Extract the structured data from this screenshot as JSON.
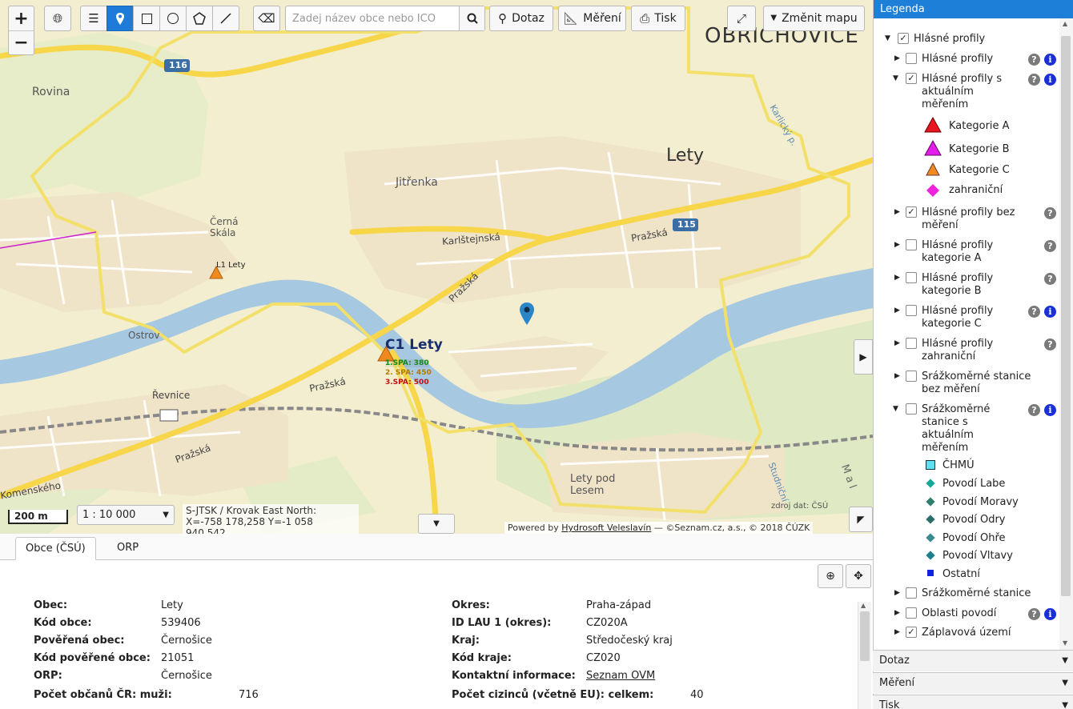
{
  "toolbar": {
    "zoom_in": "+",
    "zoom_out": "−",
    "search_placeholder": "Zadej název obce nebo IČO",
    "query_label": "Dotaz",
    "measure_label": "Měření",
    "print_label": "Tisk",
    "change_map_label": "Změnit mapu"
  },
  "map": {
    "scale_bar": "200 m",
    "scale_select": "1 : 10 000",
    "coords_line1": "S-JTSK / Krovak East North:",
    "coords_line2": "X=-758 178,258 Y=-1 058 940,542",
    "source_note": "zdroj dat: ČSÚ",
    "attribution_prefix": "Powered by",
    "attribution_link": "Hydrosoft Veleslavín",
    "attribution_suffix": "— ©Seznam.cz, a.s., © 2018 ČÚZK",
    "places": {
      "dobrichovice": "OBŘICHOVICE",
      "lety": "Lety",
      "rovina": "Rovina",
      "jitrenka": "Jitřenka",
      "cerna_skala_1": "Černá",
      "cerna_skala_2": "Skála",
      "ostrov": "Ostrov",
      "revnice": "Řevnice",
      "lety_pod_lesem_1": "Lety pod",
      "lety_pod_lesem_2": "Lesem",
      "karlstejnska": "Karlštejnská",
      "prazska_1": "Pražská",
      "prazska_2": "Pražská",
      "prazska_3": "Pražská",
      "prazska_4": "Pražská",
      "komenskeho": "Komenského",
      "karlicky": "Karlický p.",
      "studnicni": "Studniční",
      "mal": "M a l",
      "road_116": "116",
      "road_115": "115"
    },
    "station_l1": "L1 Lety",
    "station_c1": "C1 Lety",
    "spa1": "1.SPA: 380",
    "spa2": "2. SPA: 450",
    "spa3": "3.SPA: 500"
  },
  "bottom": {
    "tab_obce": "Obce (ČSÚ)",
    "tab_orp": "ORP",
    "rows_left": [
      {
        "k": "Obec:",
        "v": "Lety"
      },
      {
        "k": "Kód obce:",
        "v": "539406"
      },
      {
        "k": "Pověřená obec:",
        "v": "Černošice"
      },
      {
        "k": "Kód pověřené obce:",
        "v": "21051"
      },
      {
        "k": "ORP:",
        "v": "Černošice"
      },
      {
        "k": "Počet občanů ČR: muži:",
        "v": "716"
      }
    ],
    "rows_right": [
      {
        "k": "Okres:",
        "v": "Praha-západ"
      },
      {
        "k": "ID LAU 1 (okres):",
        "v": "CZ020A"
      },
      {
        "k": "Kraj:",
        "v": "Středočeský kraj"
      },
      {
        "k": "Kód kraje:",
        "v": "CZ020"
      },
      {
        "k": "Kontaktní informace:",
        "v": "Seznam OVM"
      },
      {
        "k": "Počet cizinců (včetně EU): celkem:",
        "v": "40"
      }
    ]
  },
  "legend": {
    "title": "Legenda",
    "root": "Hlásné profily",
    "items": {
      "hp": "Hlásné profily",
      "hp_akt": "Hlásné profily s aktuálním měřením",
      "kat_a": "Kategorie A",
      "kat_b": "Kategorie B",
      "kat_c": "Kategorie C",
      "zahr": "zahraniční",
      "hp_bez": "Hlásné profily bez měření",
      "hp_a": "Hlásné profily kategorie A",
      "hp_b": "Hlásné profily kategorie B",
      "hp_c": "Hlásné profily kategorie C",
      "hp_z": "Hlásné profily zahraniční",
      "srz_bez": "Srážkoměrné stanice bez měření",
      "srz_akt": "Srážkoměrné stanice s aktuálním měřením",
      "chmu": "ČHMÚ",
      "labe": "Povodí Labe",
      "morava": "Povodí Moravy",
      "odra": "Povodí Odry",
      "ohre": "Povodí Ohře",
      "vltava": "Povodí Vltavy",
      "ostatni": "Ostatní",
      "srz": "Srážkoměrné stanice",
      "oblasti": "Oblasti povodí",
      "zaplav": "Záplavová území"
    }
  },
  "accordions": {
    "dotaz": "Dotaz",
    "mereni": "Měření",
    "tisk": "Tisk"
  },
  "colors": {
    "accent": "#1e7fd9",
    "kat_a": "#e8141e",
    "kat_b": "#e01ee8",
    "kat_c": "#f0891e",
    "zahr": "#ee22dd",
    "river": "#a6c8e0",
    "boundary": "#f2e06a"
  }
}
